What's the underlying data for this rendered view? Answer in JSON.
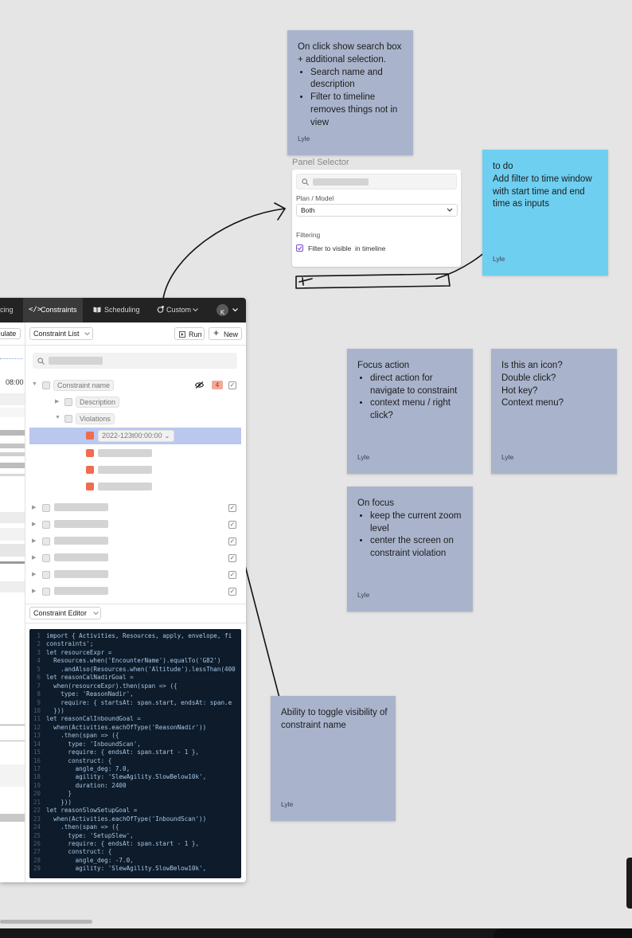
{
  "stickies": {
    "search_note": {
      "intro": "On click show search box + additional selection.",
      "bullets": [
        "Search name and description",
        "Filter to timeline removes things not in view"
      ],
      "author": "Lyle"
    },
    "todo_note": {
      "text": "to do\nAdd filter to time window with start time and end time as inputs",
      "author": "Lyle"
    },
    "focus_action": {
      "title": "Focus action",
      "bullets": [
        "direct action for navigate to constraint",
        "context menu / right click?"
      ],
      "author": "Lyle"
    },
    "icon_question": {
      "text": "Is this an icon?\nDouble click?\nHot key?\nContext menu?",
      "author": "Lyle"
    },
    "on_focus": {
      "title": "On focus",
      "bullets": [
        "keep the current zoom level",
        "center the screen on constraint violation"
      ],
      "author": "Lyle"
    },
    "toggle_visibility": {
      "text": "Ability to toggle visibility of constraint name",
      "author": "Lyle"
    }
  },
  "panel_selector": {
    "title": "Panel Selector",
    "plan_model_label": "Plan / Model",
    "plan_model_value": "Both",
    "filtering_label": "Filtering",
    "filter_checkbox_label": "Filter to visible  in timeline",
    "filter_checked": true
  },
  "app": {
    "nav": {
      "partial_tab": "cing",
      "constraints_tab": "Constraints",
      "scheduling_tab": "Scheduling",
      "custom_tab": "Custom",
      "avatar_initial": "K",
      "constraints_icon": "</>"
    },
    "left_strip": {
      "button_partial": "ulate",
      "time_label": "08:00"
    },
    "list_header": {
      "selector_label": "Constraint List",
      "run_label": "Run",
      "new_label": "New"
    },
    "tree": {
      "constraint_name": "Constraint name",
      "violation_count": "4",
      "description": "Description",
      "violations": "Violations",
      "violation_time": "2022-123t00:00:00"
    },
    "editor": {
      "selector_label": "Constraint Editor",
      "code_lines": [
        "import { Activities, Resources, apply, envelope, fi",
        "constraints';",
        "let resourceExpr =",
        "  Resources.when('EncounterName').equalTo('G82')",
        "    .andAlso(Resources.when('Altitude').lessThan(400",
        "let reasonCalNadirGoal =",
        "  when(resourceExpr).then(span => ({",
        "    type: 'ReasonNadir',",
        "    require: { startsAt: span.start, endsAt: span.e",
        "  }))",
        "let reasonCalInboundGoal =",
        "  when(Activities.eachOfType('ReasonNadir'))",
        "    .then(span => ({",
        "      type: 'InboundScan',",
        "      require: { endsAt: span.start - 1 },",
        "      construct: {",
        "        angle_deg: 7.0,",
        "        agility: 'SlewAgility.SlowBelow10k',",
        "        duration: 2400",
        "      }",
        "    }))",
        "let reasonSlowSetupGoal =",
        "  when(Activities.eachOfType('InboundScan'))",
        "    .then(span => ({",
        "      type: 'SetupSlew',",
        "      require: { endsAt: span.start - 1 },",
        "      construct: {",
        "        angle_deg: -7.0,",
        "        agility: 'SlewAgility.SlowBelow10k',"
      ]
    }
  },
  "colors": {
    "sticky_grey": "#a9b4cc",
    "sticky_blue": "#6ecff0",
    "violation": "#ef6c4f",
    "selected_row": "#bac8ef",
    "code_bg": "#0d1b2a",
    "nav_bg": "#232323"
  },
  "icons": [
    "search-icon",
    "eye-slash-icon",
    "play-icon",
    "plus-icon",
    "chevron-down-icon",
    "code-icon",
    "book-icon",
    "custom-icon",
    "check-icon"
  ]
}
